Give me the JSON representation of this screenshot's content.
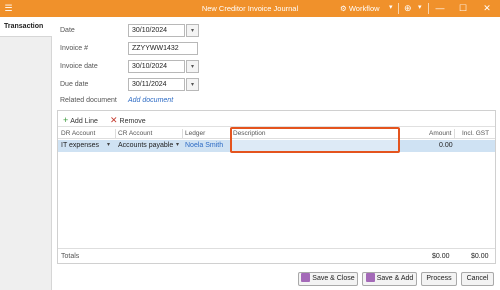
{
  "window": {
    "title": "New Creditor Invoice Journal",
    "workflow_label": "Workflow"
  },
  "sidebar": {
    "tab": "Transaction"
  },
  "form": {
    "date_label": "Date",
    "date_value": "30/10/2024",
    "invoice_num_label": "Invoice #",
    "invoice_num_value": "ZZYYWW1432",
    "invoice_date_label": "Invoice date",
    "invoice_date_value": "30/10/2024",
    "due_date_label": "Due date",
    "due_date_value": "30/11/2024",
    "related_doc_label": "Related document",
    "add_document_link": "Add document"
  },
  "grid": {
    "toolbar": {
      "add_line": "Add Line",
      "remove": "Remove"
    },
    "columns": [
      "DR Account",
      "CR Account",
      "Ledger",
      "Description",
      "Amount",
      "Incl. GST"
    ],
    "rows": [
      {
        "dr_account": "IT expenses",
        "cr_account": "Accounts payable",
        "ledger": "Noela Smith",
        "description": "",
        "amount": "0.00",
        "incl_gst": ""
      }
    ],
    "totals_label": "Totals",
    "total_amount": "$0.00",
    "total_incl_gst": "$0.00"
  },
  "footer": {
    "save_close": "Save & Close",
    "save_add": "Save & Add",
    "process": "Process",
    "cancel": "Cancel"
  },
  "colors": {
    "titlebar": "#f0912b",
    "selected_row": "#cfe2f3",
    "highlight_box": "#e4541e",
    "link": "#2d6bc4"
  }
}
